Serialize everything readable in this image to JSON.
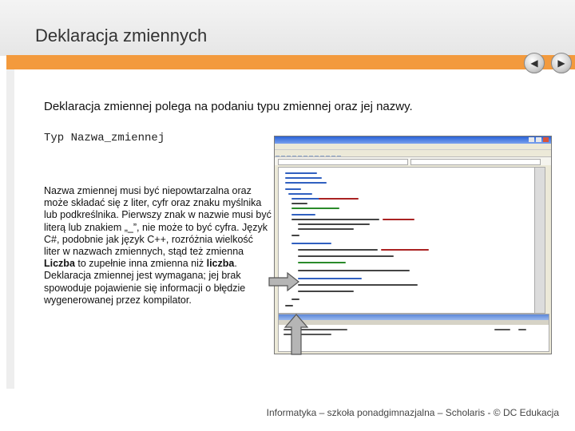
{
  "slide": {
    "title": "Deklaracja zmiennych",
    "lead": "Deklaracja zmiennej polega na podaniu typu zmiennej oraz jej nazwy.",
    "code": "Typ Nazwa_zmiennej",
    "paragraph": {
      "before_bold": "Nazwa zmiennej musi być niepowtarzalna oraz może składać się z liter, cyfr oraz znaku myślnika lub podkreślnika. Pierwszy znak w nazwie musi być literą lub znakiem „_”, nie może to być cyfra. Język C#, podobnie jak język C++, rozróżnia wielkość liter w nazwach zmiennych, stąd też zmienna ",
      "bold1": "Liczba",
      "middle": " to zupełnie inna zmienna niż ",
      "bold2": "liczba",
      "after_bold": ". Deklaracja zmiennej jest wymagana; jej brak spowoduje pojawienie się informacji o błędzie wygenerowanej przez kompilator."
    },
    "footer": "Informatyka – szkoła ponadgimnazjalna – Scholaris - © DC Edukacja"
  },
  "nav": {
    "back_icon": "back-arrow-icon",
    "forward_icon": "forward-arrow-icon"
  },
  "colors": {
    "accent": "#f39a3d",
    "ide_title": "#2a62d6"
  }
}
